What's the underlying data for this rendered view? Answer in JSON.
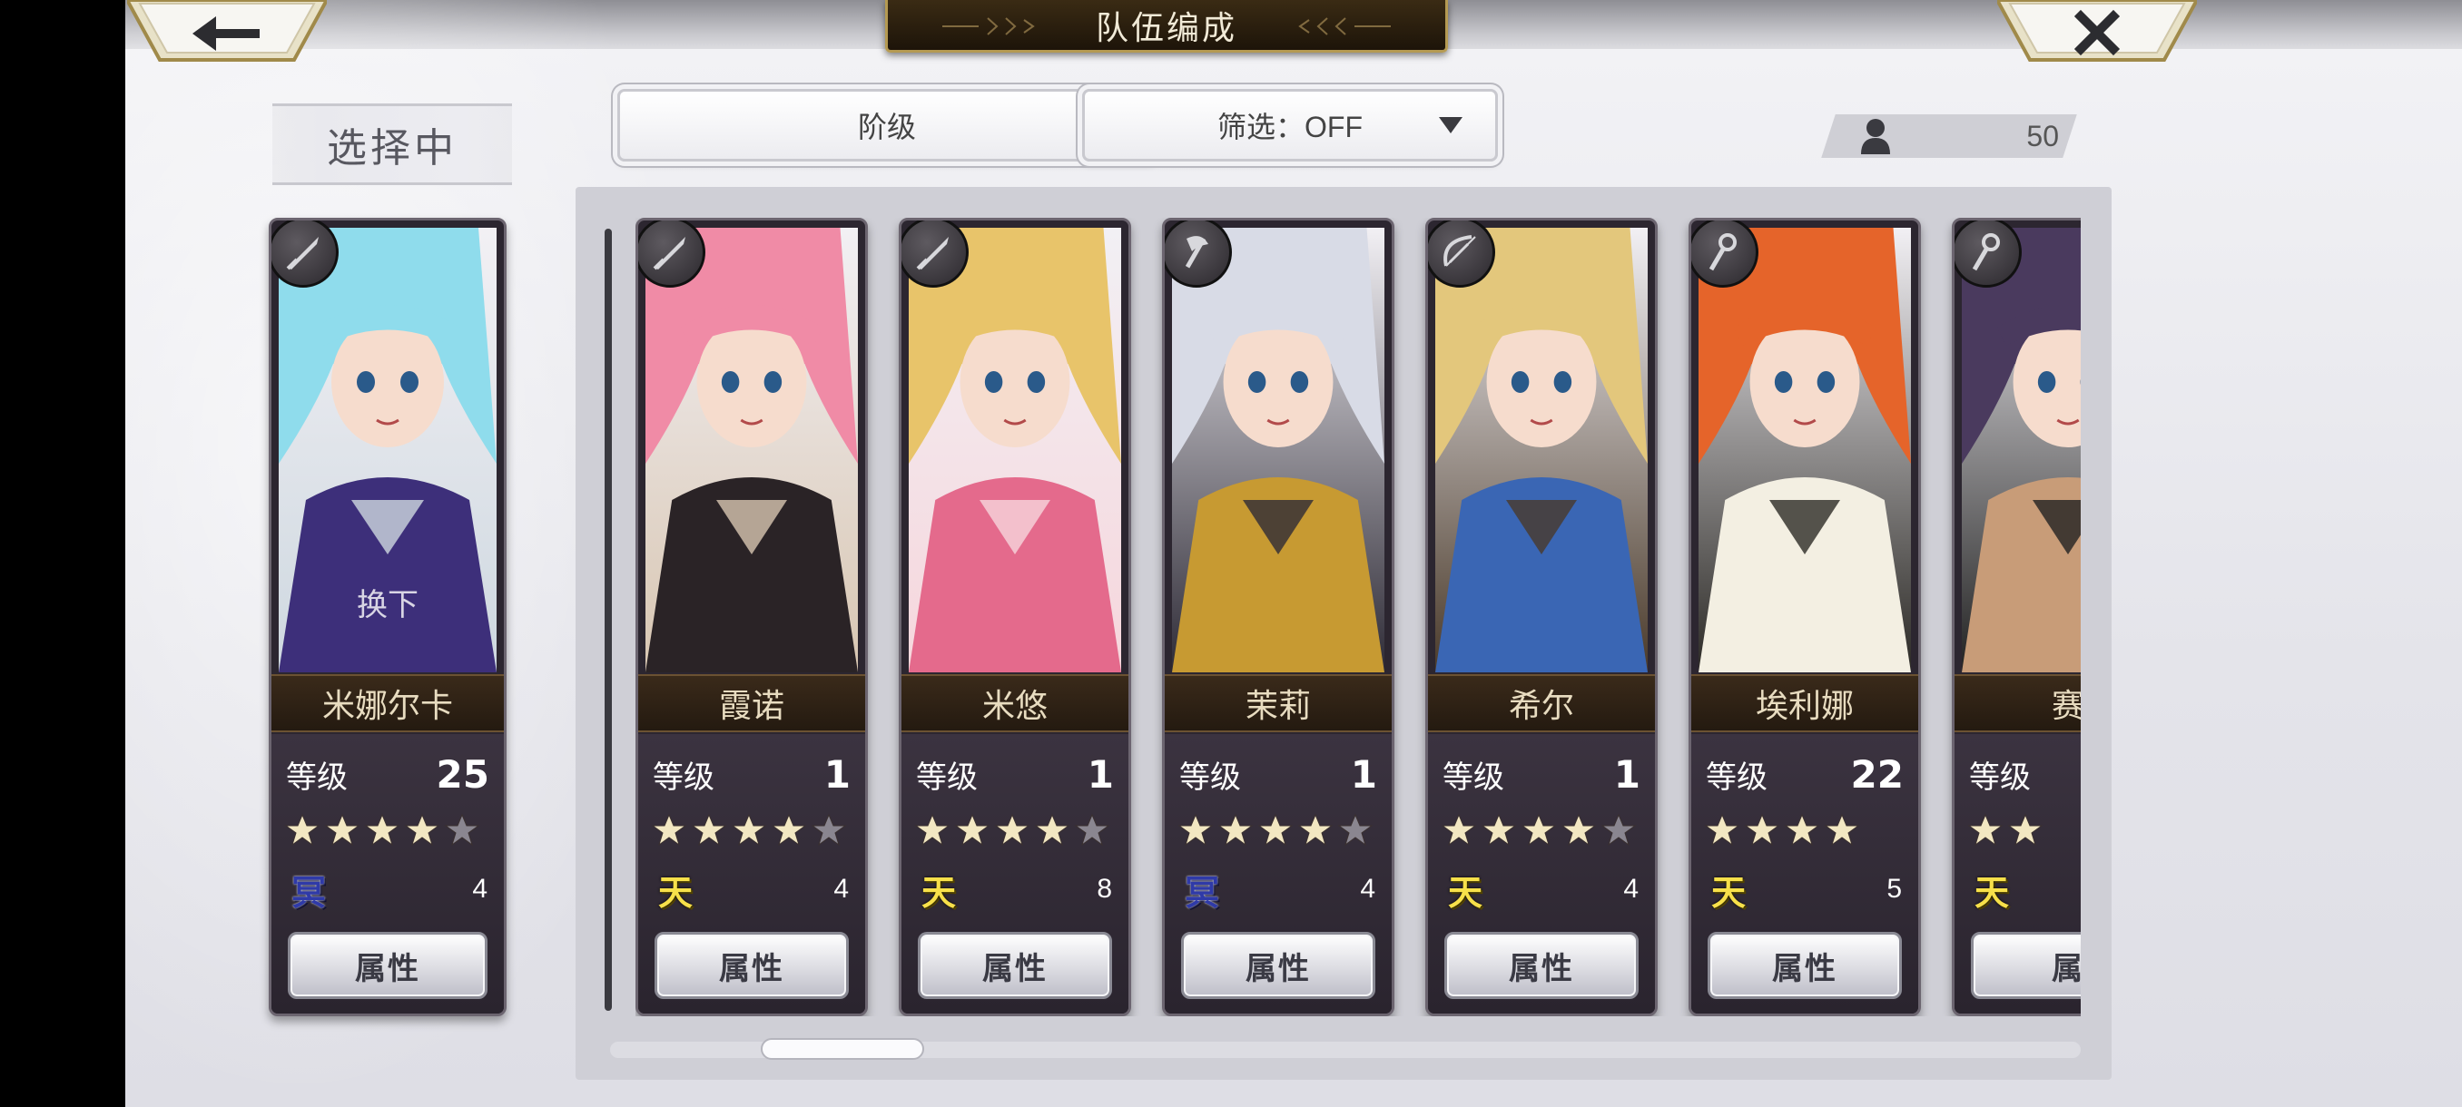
{
  "header": {
    "title": "队伍编成"
  },
  "selected": {
    "label": "选择中",
    "character": {
      "name": "米娜尔卡",
      "level_label": "等级",
      "level": "25",
      "stars": 4,
      "max_stars": 5,
      "element": "冥",
      "element_type": "ming",
      "count": "4",
      "button": "属性",
      "swap_text": "换下",
      "weapon": "sword",
      "palette": [
        "#8fdcec",
        "#3d2f7a",
        "#ced8e0"
      ]
    }
  },
  "controls": {
    "sort": {
      "value": "阶级"
    },
    "filter": {
      "value": "筛选：OFF"
    },
    "count": {
      "value": "50"
    }
  },
  "characters": [
    {
      "name": "霞诺",
      "level_label": "等级",
      "level": "1",
      "stars": 4,
      "max_stars": 5,
      "element": "天",
      "element_type": "tian",
      "count": "4",
      "button": "属性",
      "weapon": "sword",
      "palette": [
        "#f08ba6",
        "#2a2326",
        "#d8c6b2"
      ]
    },
    {
      "name": "米悠",
      "level_label": "等级",
      "level": "1",
      "stars": 4,
      "max_stars": 5,
      "element": "天",
      "element_type": "tian",
      "count": "8",
      "button": "属性",
      "weapon": "sword",
      "palette": [
        "#e8c46a",
        "#e46a8c",
        "#f6d6dc"
      ]
    },
    {
      "name": "茉莉",
      "level_label": "等级",
      "level": "1",
      "stars": 4,
      "max_stars": 5,
      "element": "冥",
      "element_type": "ming",
      "count": "4",
      "button": "属性",
      "weapon": "axe",
      "palette": [
        "#d8dbe6",
        "#c79a32",
        "#2e2b36"
      ]
    },
    {
      "name": "希尔",
      "level_label": "等级",
      "level": "1",
      "stars": 4,
      "max_stars": 5,
      "element": "天",
      "element_type": "tian",
      "count": "4",
      "button": "属性",
      "weapon": "bow",
      "palette": [
        "#e3c77c",
        "#3a66b4",
        "#4a3a2a"
      ]
    },
    {
      "name": "埃利娜",
      "level_label": "等级",
      "level": "22",
      "stars": 4,
      "max_stars": 4,
      "element": "天",
      "element_type": "tian",
      "count": "5",
      "button": "属性",
      "weapon": "staff",
      "palette": [
        "#e5642a",
        "#f3efe2",
        "#2c2a26"
      ]
    },
    {
      "name": "赛",
      "level_label": "等级",
      "level": "",
      "stars": 2,
      "max_stars": 2,
      "element": "天",
      "element_type": "tian",
      "count": "",
      "button": "属",
      "weapon": "staff",
      "palette": [
        "#4a3a5e",
        "#c89c78",
        "#222"
      ]
    }
  ]
}
